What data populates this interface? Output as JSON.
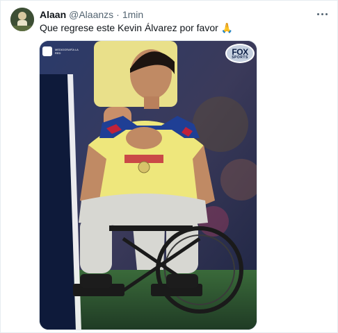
{
  "tweet": {
    "display_name": "Alaan",
    "handle": "@Alaanzs",
    "separator": "·",
    "time": "1min",
    "text": "Que regrese este Kevin Álvarez por favor",
    "emoji": "🙏"
  },
  "media": {
    "watermark_text": "MEDIOGRAFÍA LA RED",
    "broadcaster_top": "FOX",
    "broadcaster_bottom": "SPORTS"
  },
  "colors": {
    "name": "#0f1419",
    "meta": "#536471",
    "jersey_yellow": "#efe57a",
    "jersey_blue": "#1f3f95"
  },
  "icons": [
    "more-icon",
    "avatar",
    "prayer-hands-emoji",
    "fox-sports-logo"
  ]
}
